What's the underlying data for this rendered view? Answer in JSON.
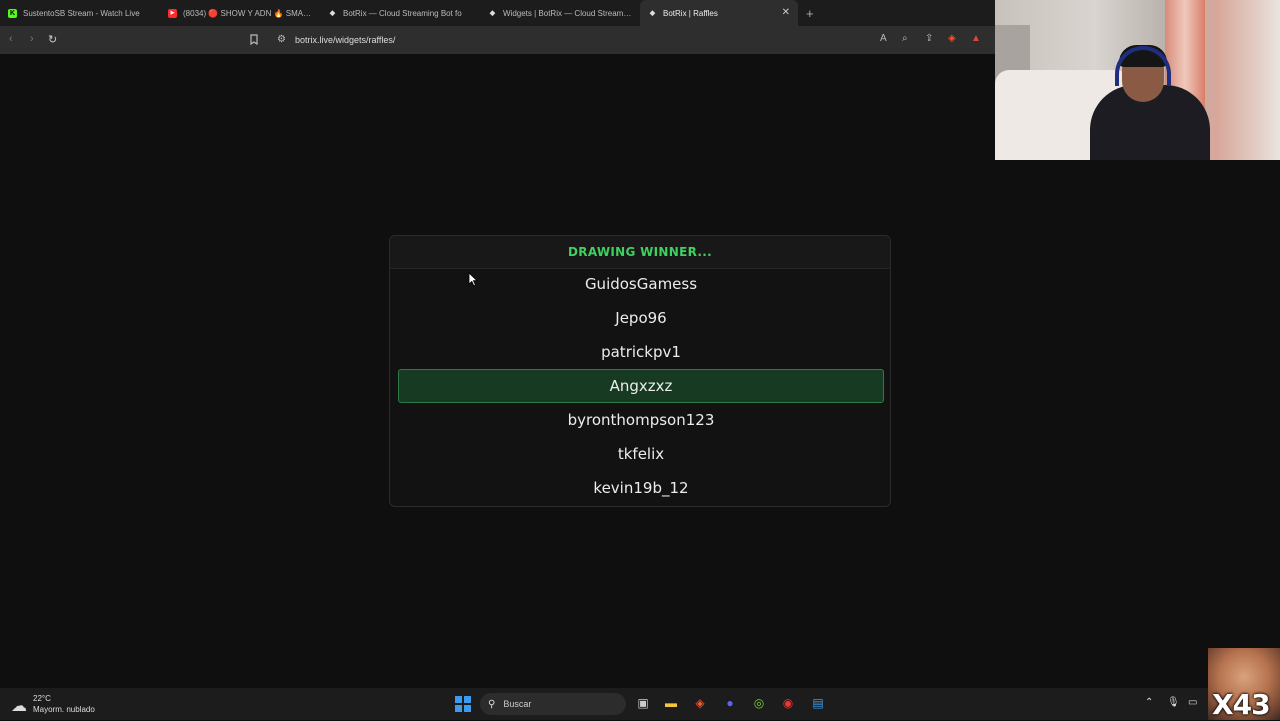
{
  "browser": {
    "tabs": [
      {
        "title": "SustentoSB Stream - Watch Live",
        "icon": "kick-logo-icon",
        "color": "#53fc18",
        "glyph": "K"
      },
      {
        "title": "(8034) 🔴 SHOW Y ADN 🔥 SMASH V",
        "icon": "youtube-logo-icon",
        "color": "#ff2a2a",
        "glyph": "▶"
      },
      {
        "title": "BotRix — Cloud Streaming Bot fo",
        "icon": "botrix-logo-icon",
        "color": "#6c6c6c",
        "glyph": "◆"
      },
      {
        "title": "Widgets | BotRix — Cloud Streaming",
        "icon": "botrix-logo-icon",
        "color": "#6c6c6c",
        "glyph": "◆"
      },
      {
        "title": "BotRix | Raffles",
        "icon": "botrix-logo-icon",
        "color": "#6c6c6c",
        "glyph": "◆",
        "active": true
      }
    ],
    "url": "botrix.live/widgets/raffles/"
  },
  "raffle": {
    "status": "DRAWING WINNER...",
    "entries": [
      "GuidosGamess",
      "Jepo96",
      "patrickpv1",
      "Angxzxz",
      "byronthompson123",
      "tkfelix",
      "kevin19b_12"
    ],
    "highlighted_index": 3,
    "accent_color": "#3ed160"
  },
  "taskbar": {
    "weather_temp": "22°C",
    "weather_desc": "Mayorm. nublado",
    "search_placeholder": "Buscar"
  },
  "overlay": {
    "meme_text": "X43"
  }
}
